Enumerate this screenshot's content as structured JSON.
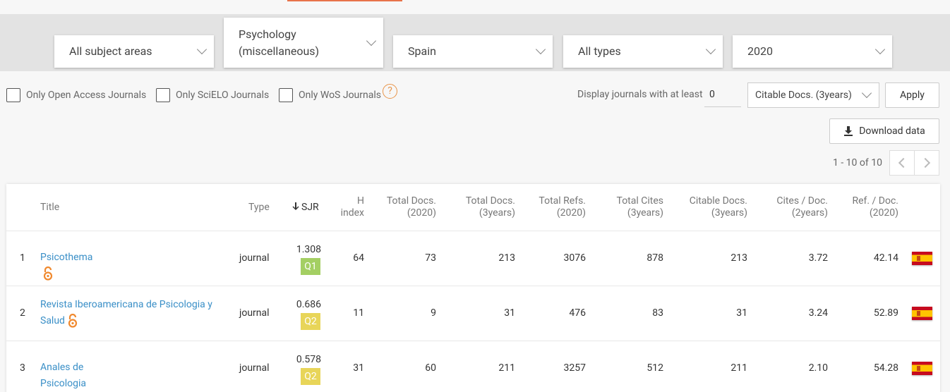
{
  "filters": {
    "subject_area": "All subject areas",
    "subject_category_line1": "Psychology",
    "subject_category_line2": "(miscellaneous)",
    "country": "Spain",
    "type": "All types",
    "year": "2020"
  },
  "checkboxes": {
    "open_access": "Only Open Access Journals",
    "scielo": "Only SciELO Journals",
    "wos": "Only WoS Journals",
    "help": "?"
  },
  "display_filter": {
    "label": "Display journals with at least",
    "min_value": "0",
    "metric": "Citable Docs. (3years)",
    "apply": "Apply"
  },
  "download_label": "Download data",
  "pagination": "1 - 10 of 10",
  "headers": {
    "title": "Title",
    "type": "Type",
    "sjr": "SJR",
    "h_index_1": "H",
    "h_index_2": "index",
    "total_docs_1": "Total Docs.",
    "total_docs_2": "(2020)",
    "total_docs3_1": "Total Docs.",
    "total_docs3_2": "(3years)",
    "total_refs_1": "Total Refs.",
    "total_refs_2": "(2020)",
    "total_cites_1": "Total Cites",
    "total_cites_2": "(3years)",
    "citable_1": "Citable Docs.",
    "citable_2": "(3years)",
    "cites_doc_1": "Cites / Doc.",
    "cites_doc_2": "(2years)",
    "ref_doc_1": "Ref. / Doc.",
    "ref_doc_2": "(2020)"
  },
  "rows": [
    {
      "rank": "1",
      "title": "Psicothema",
      "title2": "",
      "type": "journal",
      "sjr": "1.308",
      "quartile": "Q1",
      "quartile_color": "#a4cf63",
      "h_index": "64",
      "total_docs": "73",
      "total_docs_3y": "213",
      "total_refs": "3076",
      "total_cites": "878",
      "citable_docs": "213",
      "cites_per_doc": "3.72",
      "ref_per_doc": "42.14",
      "country_flag": "Spain"
    },
    {
      "rank": "2",
      "title": "Revista Iberoamericana de Psicologia y",
      "title2": "Salud",
      "type": "journal",
      "sjr": "0.686",
      "quartile": "Q2",
      "quartile_color": "#e8d559",
      "h_index": "11",
      "total_docs": "9",
      "total_docs_3y": "31",
      "total_refs": "476",
      "total_cites": "83",
      "citable_docs": "31",
      "cites_per_doc": "3.24",
      "ref_per_doc": "52.89",
      "country_flag": "Spain"
    },
    {
      "rank": "3",
      "title": "Anales de Psicologia",
      "title2": "",
      "type": "journal",
      "sjr": "0.578",
      "quartile": "Q2",
      "quartile_color": "#e8d559",
      "h_index": "31",
      "total_docs": "60",
      "total_docs_3y": "211",
      "total_refs": "3257",
      "total_cites": "512",
      "citable_docs": "211",
      "cites_per_doc": "2.10",
      "ref_per_doc": "54.28",
      "country_flag": "Spain"
    }
  ],
  "colors": {
    "accent": "#e8734a",
    "link": "#3a8fc7",
    "oa_icon": "#f0892e"
  }
}
